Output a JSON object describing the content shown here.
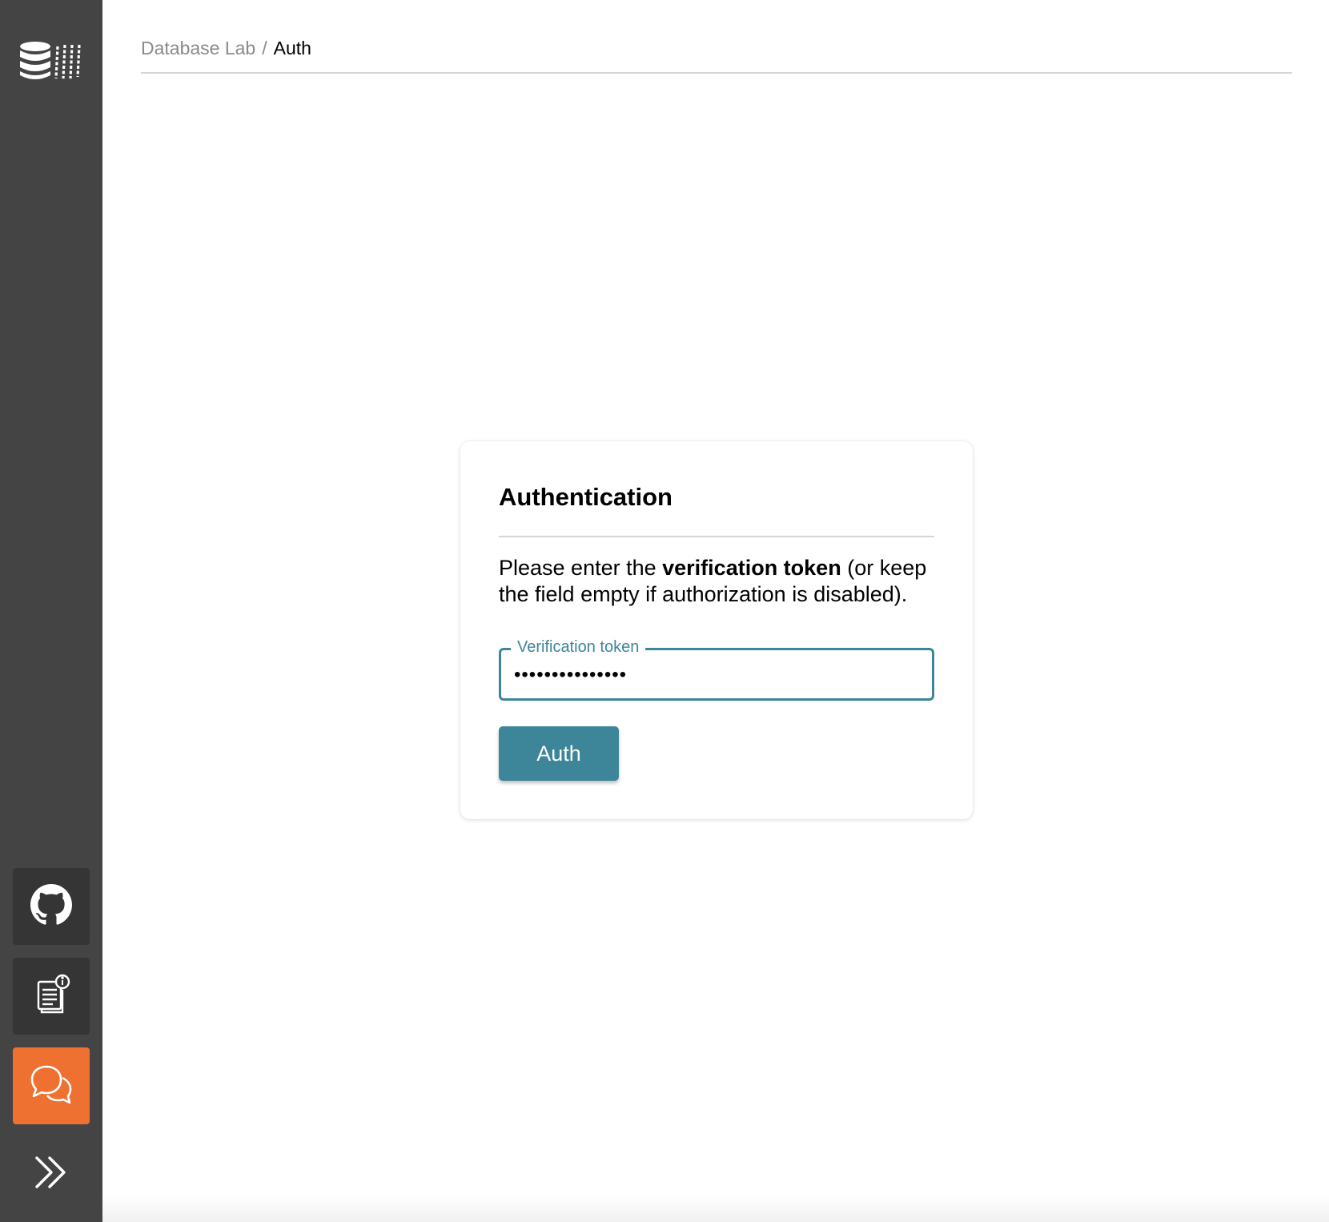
{
  "breadcrumb": {
    "parent": "Database Lab",
    "separator": "/",
    "current": "Auth"
  },
  "sidebar": {
    "logo_icon": "database-lab-logo-icon",
    "items": [
      {
        "name": "github",
        "icon": "github-icon"
      },
      {
        "name": "docs",
        "icon": "docs-icon"
      },
      {
        "name": "chat",
        "icon": "chat-icon",
        "color": "#ef7131"
      }
    ],
    "expand_icon": "double-chevron-right-icon"
  },
  "auth_card": {
    "title": "Authentication",
    "description_prefix": "Please enter the ",
    "description_bold": "verification token",
    "description_suffix": " (or keep the field empty if authorization is disabled).",
    "field_label": "Verification token",
    "field_value": "•••••••••••••••",
    "button_label": "Auth"
  },
  "colors": {
    "sidebar_bg": "#444444",
    "accent": "#3d8599",
    "chat_button": "#ef7131"
  }
}
